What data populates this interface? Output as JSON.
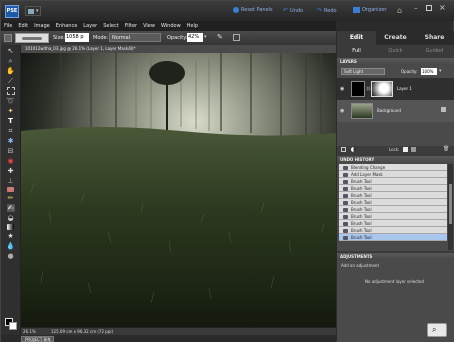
{
  "title_bar": {
    "app_logo": "PSE",
    "reset_panels": "Reset Panels",
    "undo": "Undo",
    "redo": "Redo",
    "organizer": "Organizer"
  },
  "menu": [
    "File",
    "Edit",
    "Image",
    "Enhance",
    "Layer",
    "Select",
    "Filter",
    "View",
    "Window",
    "Help"
  ],
  "options": {
    "size_label": "Size:",
    "size_value": "1058 p",
    "mode_label": "Mode:",
    "mode_value": "Normal",
    "opacity_label": "Opacity:",
    "opacity_value": "42%"
  },
  "document_tab": "101012witha_03.jpg @ 26.1% (Layer 1, Layer Mask/8)*",
  "status": {
    "zoom": "26.1%",
    "doc_size": "125.09 cm x 96.32 cm (72 ppi)"
  },
  "project_bin": "PROJECT BIN",
  "mode_tabs": [
    "Edit",
    "Create",
    "Share"
  ],
  "sub_tabs": [
    "Full",
    "Quick",
    "Guided"
  ],
  "layers": {
    "header": "LAYERS",
    "blend_mode": "Soft Light",
    "opacity_label": "Opacity:",
    "opacity_value": "100%",
    "lock_label": "Lock:",
    "items": [
      {
        "name": "Layer 1"
      },
      {
        "name": "Background"
      }
    ]
  },
  "history": {
    "header": "UNDO HISTORY",
    "items": [
      "Blending Change",
      "Add Layer Mask",
      "Brush Tool",
      "Brush Tool",
      "Brush Tool",
      "Brush Tool",
      "Brush Tool",
      "Brush Tool",
      "Brush Tool",
      "Brush Tool",
      "Brush Tool"
    ]
  },
  "adjustments": {
    "header": "ADJUSTMENTS",
    "add_text": "Add an adjustment",
    "none_text": "No adjustment layer selected"
  },
  "colors": {
    "accent": "#1e6ed8",
    "history_selected": "#a9c6ef"
  }
}
